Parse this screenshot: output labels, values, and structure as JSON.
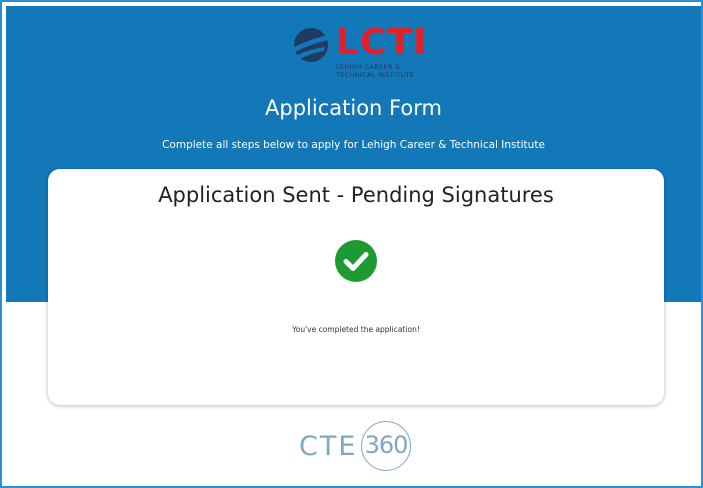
{
  "logo": {
    "wordmark": "LCTI",
    "subtitle": "LEHIGH CAREER & TECHNICAL INSTITUTE"
  },
  "header": {
    "title": "Application Form",
    "subtitle": "Complete all steps below to apply for Lehigh Career & Technical Institute"
  },
  "card": {
    "heading": "Application Sent - Pending Signatures",
    "message": "You've completed the application!",
    "status_icon": "check-circle-icon"
  },
  "footer_logo": {
    "text": "CTE",
    "number": "360"
  },
  "colors": {
    "header_band": "#1278b8",
    "frame_border": "#2c8fd6",
    "logo_red": "#e0202b",
    "logo_navy": "#1f3b63",
    "success_green": "#1e9a33",
    "cte_blue": "#7fa6c2"
  }
}
